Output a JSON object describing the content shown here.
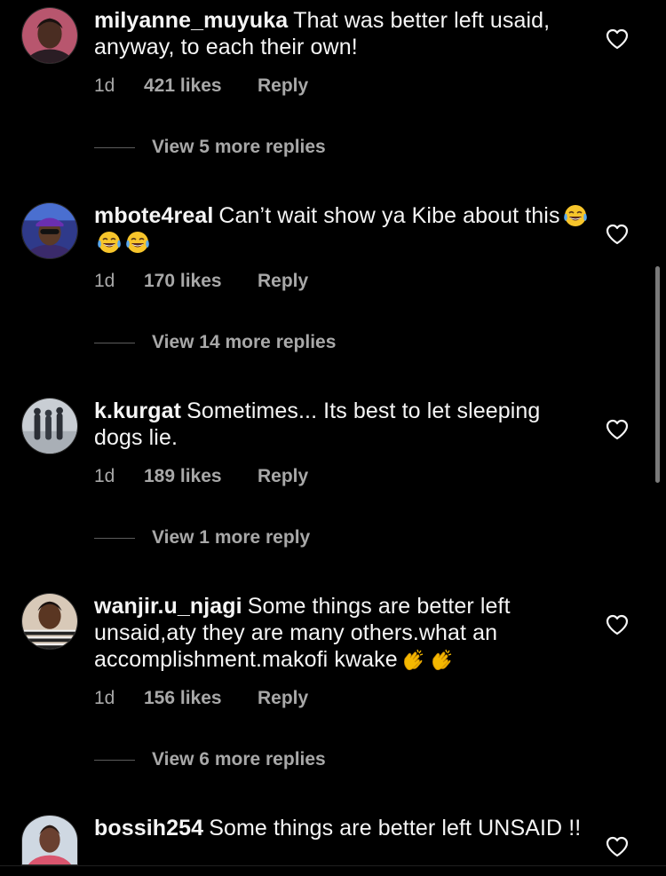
{
  "comments": [
    {
      "username": "milyanne_muyuka",
      "text": "That was better left usaid, anyway, to each their own!",
      "time": "1d",
      "likes": "421 likes",
      "reply_label": "Reply",
      "view_more": "View 5 more replies",
      "liked": false
    },
    {
      "username": "mbote4real",
      "text": "Can’t wait show ya Kibe about this",
      "emoji": [
        "tears-of-joy-emoji",
        "tears-of-joy-emoji",
        "tears-of-joy-emoji"
      ],
      "time": "1d",
      "likes": "170 likes",
      "reply_label": "Reply",
      "view_more": "View 14 more replies",
      "liked": false
    },
    {
      "username": "k.kurgat",
      "text": "Sometimes... Its best to let sleeping dogs lie.",
      "time": "1d",
      "likes": "189 likes",
      "reply_label": "Reply",
      "view_more": "View 1 more reply",
      "liked": false
    },
    {
      "username": "wanjir.u_njagi",
      "text": "Some things are better left unsaid,aty they are many others.what an accomplishment.makofi kwake",
      "emoji": [
        "clapping-hands-emoji",
        "clapping-hands-emoji"
      ],
      "time": "1d",
      "likes": "156 likes",
      "reply_label": "Reply",
      "view_more": "View 6 more replies",
      "liked": false
    },
    {
      "username": "bossih254",
      "text": "Some things are better left UNSAID !!",
      "liked": false
    }
  ],
  "colors": {
    "background": "#000000",
    "primary_text": "#f5f5f5",
    "secondary_text": "#a8a8a8",
    "scrollbar": "#7a7a7a"
  },
  "icons": {
    "like": "heart-outline-icon"
  }
}
